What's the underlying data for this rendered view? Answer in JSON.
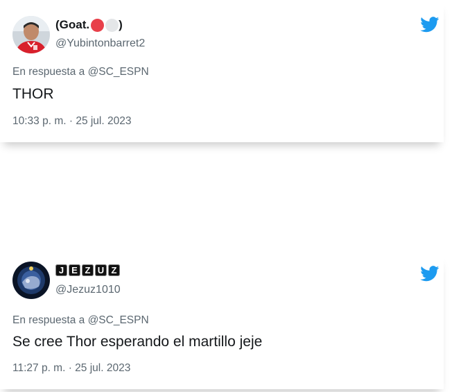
{
  "colors": {
    "twitter_blue": "#1d9bf0",
    "text_primary": "#14171a",
    "text_secondary": "#5b6770",
    "red_dot": "#e8404a",
    "white_dot": "#e4e6e8"
  },
  "tweets": [
    {
      "display_name_prefix": "(Goat.",
      "display_name_suffix": ")",
      "handle": "@Yubintonbarret2",
      "reply_to": "En respuesta a @SC_ESPN",
      "text": "THOR",
      "timestamp": "10:33 p. m. · 25 jul. 2023",
      "icon": "twitter-bird-icon"
    },
    {
      "display_name_letters": [
        "J",
        "E",
        "Z",
        "U",
        "Z"
      ],
      "handle": "@Jezuz1010",
      "reply_to": "En respuesta a @SC_ESPN",
      "text": "Se cree Thor esperando el martillo jeje",
      "timestamp": "11:27 p. m. · 25 jul. 2023",
      "icon": "twitter-bird-icon"
    }
  ]
}
